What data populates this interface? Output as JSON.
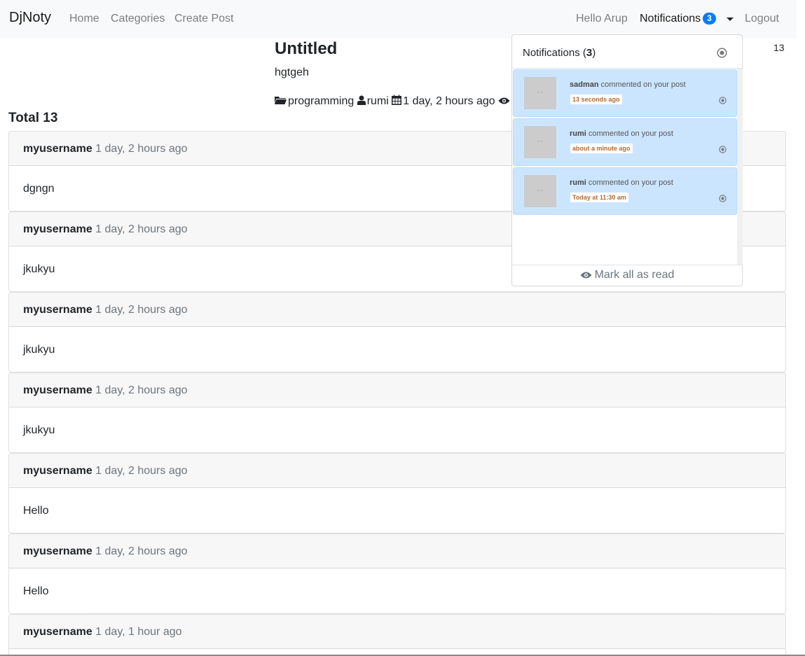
{
  "navbar": {
    "brand": "DjNoty",
    "links": [
      "Home",
      "Categories",
      "Create Post"
    ],
    "greeting": "Hello Arup",
    "notifications_label": "Notifications",
    "notifications_count": "3",
    "logout": "Logout"
  },
  "post": {
    "title": "Untitled",
    "body": "hgtgeh",
    "category": "programming",
    "author": "rumi",
    "date": "1 day, 2 hours ago",
    "side_count": "13"
  },
  "comments_total": "Total 13",
  "comments": [
    {
      "user": "myusername",
      "time": "1 day, 2 hours ago",
      "text": "dgngn"
    },
    {
      "user": "myusername",
      "time": "1 day, 2 hours ago",
      "text": "jkukyu"
    },
    {
      "user": "myusername",
      "time": "1 day, 2 hours ago",
      "text": "jkukyu"
    },
    {
      "user": "myusername",
      "time": "1 day, 2 hours ago",
      "text": "jkukyu"
    },
    {
      "user": "myusername",
      "time": "1 day, 2 hours ago",
      "text": "Hello"
    },
    {
      "user": "myusername",
      "time": "1 day, 2 hours ago",
      "text": "Hello"
    },
    {
      "user": "myusername",
      "time": "1 day, 1 hour ago",
      "text": ""
    }
  ],
  "dropdown": {
    "header_label": "Notifications (",
    "header_count": "3",
    "header_close": ")",
    "items": [
      {
        "actor": "sadman",
        "action": "commented on your post",
        "time": "13 seconds ago"
      },
      {
        "actor": "rumi",
        "action": "commented on your post",
        "time": "about a minute ago"
      },
      {
        "actor": "rumi",
        "action": "commented on your post",
        "time": "Today at 11:30 am"
      }
    ],
    "mark_all": "Mark all as read"
  },
  "colors": {
    "accent": "#007bff",
    "notif_bg": "#cce5ff",
    "notif_time": "#b26b32"
  },
  "icons": [
    "folder-open-icon",
    "user-icon",
    "calendar-icon",
    "eye-icon",
    "target-icon",
    "caret-down-icon"
  ]
}
